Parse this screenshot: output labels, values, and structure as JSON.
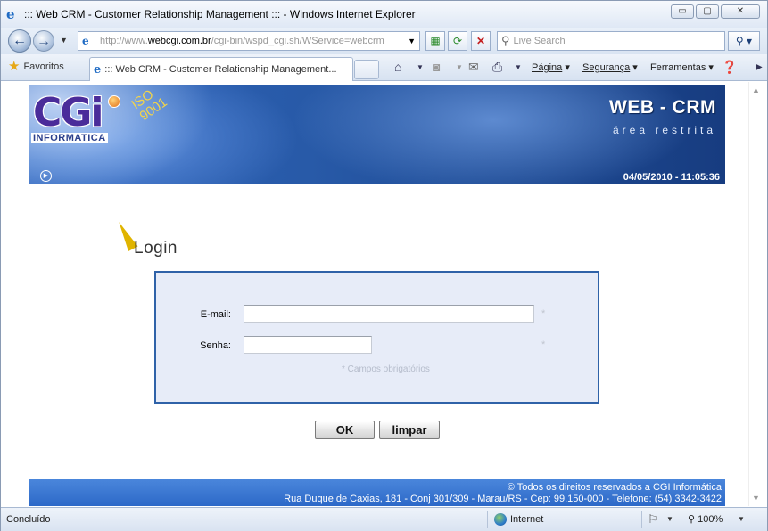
{
  "window": {
    "title": "::: Web CRM - Customer Relationship Management ::: - Windows Internet Explorer",
    "controls": {
      "minimize": "▭",
      "maximize": "▢",
      "close": "✕"
    }
  },
  "addressbar": {
    "url_prefix": "http://www.",
    "url_host": "webcgi.com.br",
    "url_path": "/cgi-bin/wspd_cgi.sh/WService=webcrm",
    "search_placeholder": "Live Search"
  },
  "commandbar": {
    "favorites": "Favoritos",
    "tab_title": "::: Web CRM - Customer Relationship Management...",
    "pagina": "Página",
    "seguranca": "Segurança",
    "ferramentas": "Ferramentas"
  },
  "banner": {
    "logo": "CGi",
    "logo_sub": "INFORMATICA",
    "iso_line1": "ISO",
    "iso_line2": "9001",
    "product": "WEB - CRM",
    "subtitle": "área restrita",
    "datetime": "04/05/2010 - 11:05:36"
  },
  "login": {
    "heading": "Login",
    "email_label": "E-mail:",
    "email_value": "",
    "password_label": "Senha:",
    "password_value": "",
    "required_marker": "*",
    "required_note": "* Campos obrigatórios",
    "ok_button": "OK",
    "clear_button": "limpar"
  },
  "footer": {
    "copyright": "© Todos os direitos reservados a CGI Informática",
    "address": "Rua Duque de Caxias, 181 - Conj 301/309 - Marau/RS - Cep: 99.150-000 - Telefone: (54) 3342-3422"
  },
  "statusbar": {
    "status": "Concluído",
    "zone": "Internet",
    "zoom": "100%"
  },
  "colors": {
    "form_border": "#2f62a8",
    "form_bg": "#e7ecf8",
    "footer_bg": "#2d69c8",
    "banner_bg": "#285aa8"
  }
}
